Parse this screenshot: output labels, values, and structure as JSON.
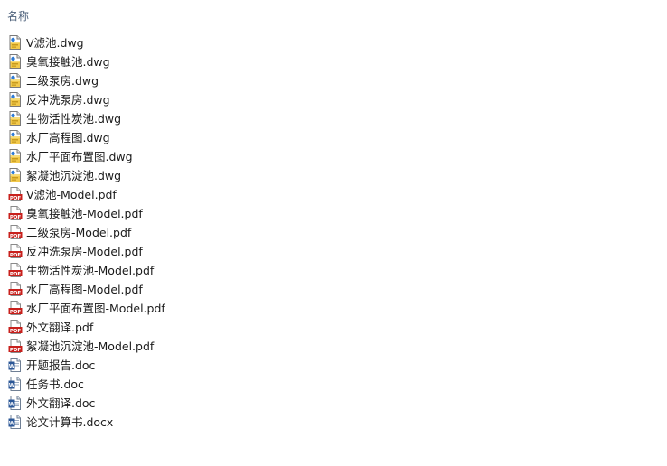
{
  "header": {
    "name_column": "名称"
  },
  "files": [
    {
      "name": "V滤池.dwg",
      "type": "dwg"
    },
    {
      "name": "臭氧接触池.dwg",
      "type": "dwg"
    },
    {
      "name": "二级泵房.dwg",
      "type": "dwg"
    },
    {
      "name": "反冲洗泵房.dwg",
      "type": "dwg"
    },
    {
      "name": "生物活性炭池.dwg",
      "type": "dwg"
    },
    {
      "name": "水厂高程图.dwg",
      "type": "dwg"
    },
    {
      "name": "水厂平面布置图.dwg",
      "type": "dwg"
    },
    {
      "name": "絮凝池沉淀池.dwg",
      "type": "dwg"
    },
    {
      "name": "V滤池-Model.pdf",
      "type": "pdf"
    },
    {
      "name": "臭氧接触池-Model.pdf",
      "type": "pdf"
    },
    {
      "name": "二级泵房-Model.pdf",
      "type": "pdf"
    },
    {
      "name": "反冲洗泵房-Model.pdf",
      "type": "pdf"
    },
    {
      "name": "生物活性炭池-Model.pdf",
      "type": "pdf"
    },
    {
      "name": "水厂高程图-Model.pdf",
      "type": "pdf"
    },
    {
      "name": "水厂平面布置图-Model.pdf",
      "type": "pdf"
    },
    {
      "name": "外文翻译.pdf",
      "type": "pdf"
    },
    {
      "name": "絮凝池沉淀池-Model.pdf",
      "type": "pdf"
    },
    {
      "name": "开题报告.doc",
      "type": "doc"
    },
    {
      "name": "任务书.doc",
      "type": "doc"
    },
    {
      "name": "外文翻译.doc",
      "type": "doc"
    },
    {
      "name": "论文计算书.docx",
      "type": "doc"
    }
  ],
  "icons": {
    "dwg": "dwg-file-icon",
    "pdf": "pdf-file-icon",
    "doc": "word-document-icon"
  },
  "colors": {
    "header_text": "#4c607a",
    "pdf_red": "#c8201c",
    "dwg_yellow": "#f2c94c",
    "word_blue": "#2b5797"
  }
}
